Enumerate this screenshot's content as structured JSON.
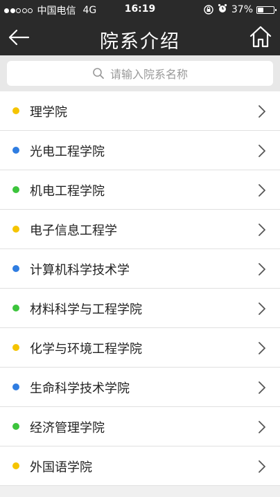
{
  "status_bar": {
    "carrier": "中国电信",
    "network": "4G",
    "time": "16:19",
    "battery_text": "37%",
    "battery_level": 0.37,
    "signal_dots": [
      true,
      true,
      false,
      false,
      false
    ],
    "icons": [
      "orientation-lock-icon",
      "alarm-icon"
    ]
  },
  "nav": {
    "title": "院系介绍",
    "back_icon": "arrow-left-icon",
    "home_icon": "home-icon"
  },
  "search": {
    "placeholder": "请输入院系名称",
    "icon": "search-icon"
  },
  "colors": {
    "yellow": "#f5c400",
    "blue": "#2f7de1",
    "green": "#3cc43c",
    "header_bg": "#2a2a2a"
  },
  "departments": [
    {
      "label": "理学院",
      "dot": "yellow"
    },
    {
      "label": "光电工程学院",
      "dot": "blue"
    },
    {
      "label": "机电工程学院",
      "dot": "green"
    },
    {
      "label": "电子信息工程学",
      "dot": "yellow"
    },
    {
      "label": "计算机科学技术学",
      "dot": "blue"
    },
    {
      "label": "材料科学与工程学院",
      "dot": "green"
    },
    {
      "label": "化学与环境工程学院",
      "dot": "yellow"
    },
    {
      "label": "生命科学技术学院",
      "dot": "blue"
    },
    {
      "label": "经济管理学院",
      "dot": "green"
    },
    {
      "label": "外国语学院",
      "dot": "yellow"
    }
  ]
}
